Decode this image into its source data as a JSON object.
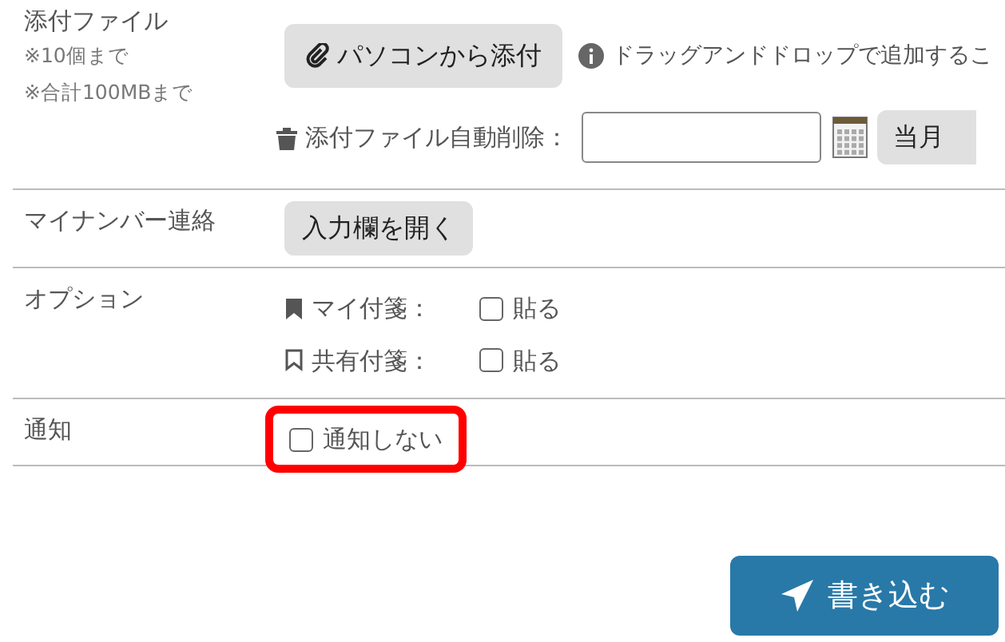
{
  "attachment": {
    "label": "添付ファイル",
    "notes": [
      "※10個まで",
      "※合計100MBまで"
    ],
    "upload_button": "パソコンから添付",
    "hint": "ドラッグアンドドロップで追加するこ",
    "auto_delete_label": "添付ファイル自動削除：",
    "date_button": "当月"
  },
  "my_number": {
    "label": "マイナンバー連絡",
    "button": "入力欄を開く"
  },
  "options": {
    "label": "オプション",
    "items": [
      {
        "kind": "filled",
        "label": "マイ付箋：",
        "checkbox": "貼る",
        "checked": false
      },
      {
        "kind": "outline",
        "label": "共有付箋：",
        "checkbox": "貼る",
        "checked": false
      }
    ]
  },
  "notify": {
    "label": "通知",
    "checkbox": "通知しない",
    "checked": false,
    "highlighted": true
  },
  "submit": "書き込む"
}
